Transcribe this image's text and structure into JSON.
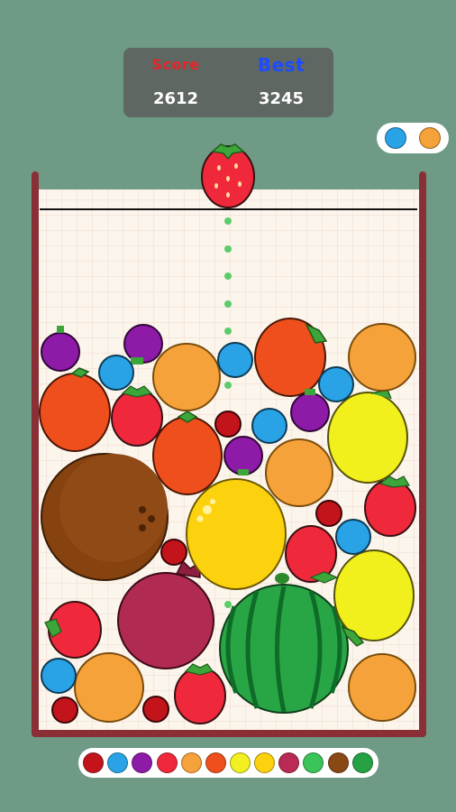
{
  "scoreboard": {
    "score_label": "Score",
    "score_value": "2612",
    "best_label": "Best",
    "best_value": "3245"
  },
  "next_queue": [
    {
      "fruit": "blueberry",
      "color": "#29a3e6"
    },
    {
      "fruit": "orange",
      "color": "#f6a23a"
    }
  ],
  "held_fruit": {
    "fruit": "strawberry",
    "color": "#f0283c"
  },
  "fruit_legend": [
    {
      "fruit": "cherry",
      "color": "#c3141c"
    },
    {
      "fruit": "blueberry",
      "color": "#29a3e6"
    },
    {
      "fruit": "grape",
      "color": "#8e1aa8"
    },
    {
      "fruit": "strawberry",
      "color": "#f0283c"
    },
    {
      "fruit": "orange",
      "color": "#f6a23a"
    },
    {
      "fruit": "persimmon",
      "color": "#ee4f1c"
    },
    {
      "fruit": "lemon",
      "color": "#f3f021"
    },
    {
      "fruit": "pineapple",
      "color": "#fcd20f"
    },
    {
      "fruit": "pomegranate",
      "color": "#b92a55"
    },
    {
      "fruit": "melon",
      "color": "#3ac45a"
    },
    {
      "fruit": "coconut",
      "color": "#8a4814"
    },
    {
      "fruit": "watermelon",
      "color": "#26a244"
    }
  ],
  "colors": {
    "background": "#6e9a86",
    "container_wall": "#8a2f35",
    "container_fill": "#fbf5ec",
    "grid_line": "#f0d9cf",
    "guide_dot": "#5ccc6a"
  }
}
